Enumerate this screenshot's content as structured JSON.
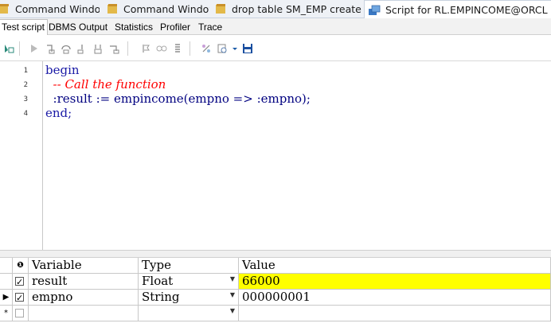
{
  "window_tabs": [
    {
      "label": "Command Window",
      "icon": "command-window-icon"
    },
    {
      "label": "Command Window",
      "icon": "command-window-icon"
    },
    {
      "label": "drop table SM_EMP create t ...",
      "icon": "command-window-icon"
    },
    {
      "label": "Script for RL.EMPINCOME@ORCL",
      "icon": "test-script-icon",
      "close": "×"
    }
  ],
  "sub_tabs": [
    "Test script",
    "DBMS Output",
    "Statistics",
    "Profiler",
    "Trace"
  ],
  "editor": {
    "line_numbers": [
      "1",
      "2",
      "3",
      "4"
    ],
    "lines": [
      "begin",
      "  -- Call the function",
      "  :result := empincome(empno => :empno);",
      "end;"
    ]
  },
  "grid": {
    "header": {
      "info_glyph": "❶",
      "variable": "Variable",
      "type": "Type",
      "value": "Value"
    },
    "rows": [
      {
        "indicator": "",
        "checked": true,
        "variable": "result",
        "type": "Float",
        "value": "66000",
        "highlight": "#ffff00"
      },
      {
        "indicator": "▶",
        "checked": true,
        "variable": "empno",
        "type": "String",
        "value": "000000001"
      },
      {
        "indicator": "*",
        "checked": false,
        "variable": "",
        "type": "",
        "value": ""
      }
    ]
  },
  "colors": {
    "keyword": "#1a1aa6",
    "comment": "#ff0000",
    "highlight": "#ffff00",
    "tab_bg": "#eef1f6"
  }
}
